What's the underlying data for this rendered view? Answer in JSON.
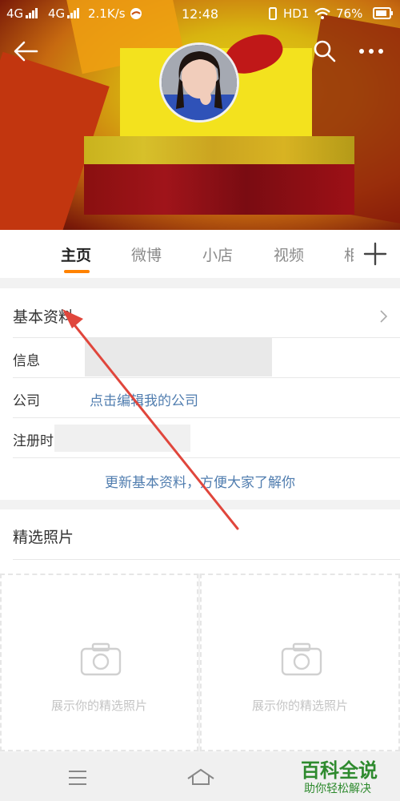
{
  "status_bar": {
    "network1": "4G",
    "network2": "4G",
    "speed": "2.1K/s",
    "time": "12:48",
    "hd": "HD1",
    "battery": "76%"
  },
  "header": {
    "back_icon": "back-arrow-icon",
    "search_icon": "search-icon",
    "more_icon": "more-dots-icon"
  },
  "tabs": [
    {
      "label": "主页",
      "active": true
    },
    {
      "label": "微博",
      "active": false
    },
    {
      "label": "小店",
      "active": false
    },
    {
      "label": "视频",
      "active": false
    },
    {
      "label": "相",
      "active": false
    }
  ],
  "accent_color": "#ff8200",
  "link_color": "#507daf",
  "profile": {
    "section_title": "基本资料",
    "rows": [
      {
        "label": "信息",
        "value": ""
      },
      {
        "label": "公司",
        "value": "点击编辑我的公司"
      },
      {
        "label": "注册时",
        "value": ""
      }
    ],
    "update_link": "更新基本资料，方便大家了解你"
  },
  "photos": {
    "title": "精选照片",
    "placeholder": "展示你的精选照片"
  },
  "watermark": {
    "title": "百科全说",
    "subtitle": "助你轻松解决"
  }
}
